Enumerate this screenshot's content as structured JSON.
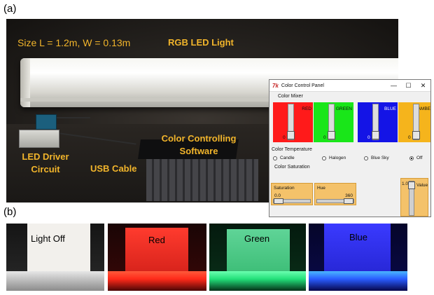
{
  "figure_labels": {
    "a": "(a)",
    "b": "(b)"
  },
  "photo_a": {
    "size_text": "Size L = 1.2m, W = 0.13m",
    "led_title": "RGB LED Light",
    "driver_text": "LED Driver Circuit",
    "usb_text": "USB Cable",
    "software_text": "Color Controlling Software"
  },
  "window": {
    "icon": "7k",
    "title": "Color Control Panel",
    "controls": {
      "minimize": "—",
      "maximize": "☐",
      "close": "✕"
    },
    "color_mixer_label": "Color Mixer",
    "mixers": [
      {
        "label": "RED",
        "value": "0",
        "color": "#ff1a1a"
      },
      {
        "label": "GREEN",
        "value": "0",
        "color": "#19e619"
      },
      {
        "label": "BLUE",
        "value": "0",
        "color": "#1414e6"
      },
      {
        "label": "AMBE",
        "value": "0",
        "color": "#f5b41c"
      }
    ],
    "temperature_label": "Color Temperature",
    "temperature_options": [
      {
        "label": "Candle",
        "selected": false
      },
      {
        "label": "Halogen",
        "selected": false
      },
      {
        "label": "Blue Sky",
        "selected": false
      },
      {
        "label": "Off",
        "selected": true
      }
    ],
    "saturation_section": "Color Saturation",
    "saturation": {
      "label": "Saturation",
      "value": "0.0"
    },
    "hue": {
      "label": "Hue",
      "value": "360"
    },
    "value_slider": {
      "label": "Value",
      "value": "1.0"
    }
  },
  "tiles": [
    {
      "label": "Light Off",
      "glow": "#c9c9c9",
      "paper": "#f2f0ec"
    },
    {
      "label": "Red",
      "glow": "#ff2a1a",
      "paper": "#d9241c"
    },
    {
      "label": "Green",
      "glow": "#23e07a",
      "paper": "#3fbf79"
    },
    {
      "label": "Blue",
      "glow": "#2a5cff",
      "paper": "#3030e6"
    }
  ]
}
